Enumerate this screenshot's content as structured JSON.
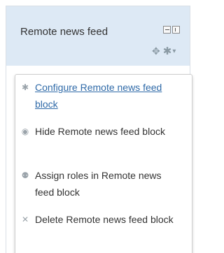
{
  "block": {
    "title": "Remote news feed"
  },
  "menu": {
    "items": [
      {
        "label": "Configure Remote news feed block",
        "icon": "gear-icon"
      },
      {
        "label": "Hide Remote news feed block",
        "icon": "eye-icon"
      },
      {
        "label": "Assign roles in Remote news feed block",
        "icon": "assign-roles-icon"
      },
      {
        "label": "Delete Remote news feed block",
        "icon": "delete-icon"
      }
    ]
  },
  "colors": {
    "header_bg": "#dde9f5",
    "link": "#2f6aa8",
    "text": "#333333",
    "icon": "#9aa3aa"
  }
}
